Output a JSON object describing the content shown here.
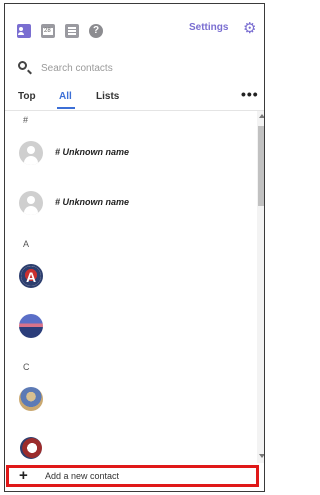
{
  "toolbar": {
    "icons": [
      "people-icon",
      "calendar-icon",
      "notes-icon",
      "help-icon"
    ],
    "settings_label": "Settings",
    "gear_glyph": "⚙"
  },
  "search": {
    "placeholder": "Search contacts",
    "value": ""
  },
  "tabs": [
    {
      "label": "Top",
      "active": false
    },
    {
      "label": "All",
      "active": true
    },
    {
      "label": "Lists",
      "active": false
    }
  ],
  "more_glyph": "•••",
  "sections": {
    "hash": "#",
    "a": "A",
    "c": "C"
  },
  "contacts": [
    {
      "name": "# Unknown name",
      "avatar": "generic"
    },
    {
      "name": "# Unknown name",
      "avatar": "generic"
    },
    {
      "name": "",
      "avatar": "letter-a",
      "avatar_letter": "A"
    },
    {
      "name": "",
      "avatar": "landscape"
    },
    {
      "name": "",
      "avatar": "photo"
    },
    {
      "name": "",
      "avatar": "logo-c"
    }
  ],
  "add_contact": {
    "label": "Add a new contact",
    "plus_glyph": "+"
  },
  "colors": {
    "accent": "#7a6ed1",
    "tab_active": "#3c6fd6",
    "highlight": "#e01818"
  }
}
